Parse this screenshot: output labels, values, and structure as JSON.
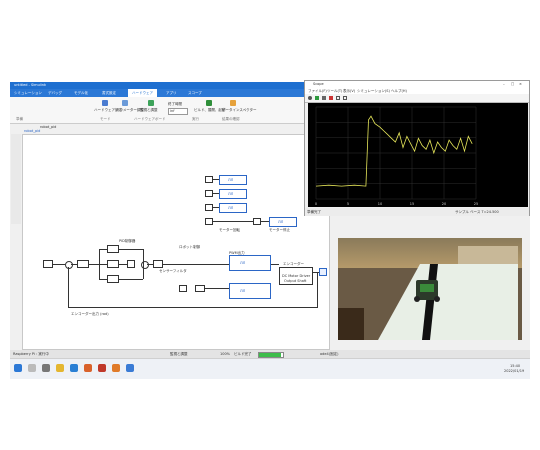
{
  "app": {
    "title": "untitled - Simulink",
    "tabs": [
      "シミュレーション",
      "デバッグ",
      "モデル化",
      "書式設定",
      "ハードウェア",
      "アプリ",
      "スコープ"
    ],
    "active_tab": "ハードウェア",
    "model_tab": "robot_pid",
    "breadcrumb": "robot_pid",
    "toolbar_buttons": [
      "ハードウェア設定",
      "パラメーター調整",
      "監視と調整",
      "終了時間",
      "ビルド、展開、起動",
      "データインスペクター"
    ],
    "toolbar_sections": [
      "準備",
      "モード",
      "ハードウェアボード",
      "実行",
      "結果の確認"
    ],
    "stop_time": "inf"
  },
  "diagram": {
    "top_blocks": [
      "モーター回転",
      "モーター停止"
    ],
    "pwm_labels": [
      "ЛЛ",
      "ЛЛ",
      "ЛЛ",
      "ЛЛ"
    ],
    "pwm_title": "PWM出力",
    "pid_label": "PID制御器",
    "sensor_label": "センサーフィルタ",
    "controller_label": "ロボット制御",
    "motor_driver_title": "DC Motor Driver",
    "motor_driver_sub": "Output Shaft",
    "block_labels": [
      "ЛЛ",
      "ЛЛ"
    ],
    "encoder_label": "エンコーダー",
    "bottom_label": "エンコーダー出力 (rad)"
  },
  "status": {
    "left": "Raspberry Pi : 実行中",
    "center": "監視と調整",
    "zoom": "100%",
    "progress_label": "ビルド完了",
    "progress": 0.9,
    "right": "ode4(固定)"
  },
  "scope": {
    "title": "Scope",
    "menu": [
      "ファイル(F)",
      "ツール(T)",
      "表示(V)",
      "シミュレーション(S)",
      "ヘルプ(H)"
    ],
    "y_ticks": [
      "",
      "",
      "",
      "",
      "",
      "",
      ""
    ],
    "x_ticks": [
      "0",
      "5",
      "10",
      "15",
      "20",
      "25"
    ],
    "status_left": "準備完了",
    "status_right": "サンプル ベース T=24.500",
    "line_color": "#e6e65a"
  },
  "camera": {
    "description_label": ""
  },
  "taskbar": {
    "time": "15:40",
    "date": "2022/01/19"
  },
  "chart_data": {
    "type": "line",
    "title": "",
    "xlabel": "",
    "ylabel": "",
    "xlim": [
      0,
      25
    ],
    "ylim": [
      0,
      1
    ],
    "grid": true,
    "series": [
      {
        "name": "",
        "x": [
          0,
          2,
          4,
          6,
          7.8,
          8.2,
          8.6,
          9.2,
          10,
          10.6,
          11.2,
          11.8,
          12.4,
          13,
          13.6,
          14.2,
          14.8,
          15.4,
          16,
          16.6,
          17.2,
          17.8,
          18.4,
          19,
          19.6,
          20.2,
          20.8,
          21.4,
          22,
          22.6,
          23.2,
          23.8,
          24.4
        ],
        "values": [
          0.14,
          0.15,
          0.14,
          0.15,
          0.14,
          0.86,
          0.9,
          0.82,
          0.78,
          0.74,
          0.7,
          0.66,
          0.62,
          0.72,
          0.56,
          0.68,
          0.6,
          0.52,
          0.66,
          0.58,
          0.54,
          0.64,
          0.5,
          0.62,
          0.56,
          0.52,
          0.64,
          0.58,
          0.54,
          0.66,
          0.52,
          0.68,
          0.6
        ]
      }
    ]
  }
}
